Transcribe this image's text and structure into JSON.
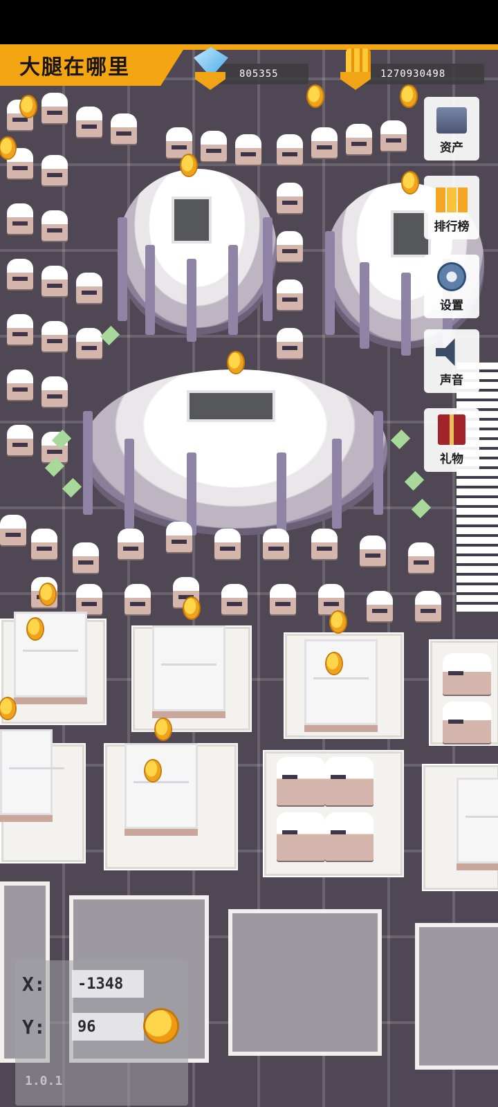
{
  "game": {
    "title": "大腿在哪里",
    "diamonds": "805355",
    "coins": "1270930498"
  },
  "side_menu": [
    {
      "label": "资产",
      "icon": "assets-icon"
    },
    {
      "label": "排行榜",
      "icon": "leaderboard-icon"
    },
    {
      "label": "设置",
      "icon": "gear-icon"
    },
    {
      "label": "声音",
      "icon": "speaker-icon"
    },
    {
      "label": "礼物",
      "icon": "gift-icon"
    }
  ],
  "coordinates": {
    "x_label": "X:",
    "x_value": "-1348",
    "y_label": "Y:",
    "y_value": "96"
  },
  "version": "1.0.1",
  "colors": {
    "accent": "#f3a512",
    "road": "#4f4854",
    "coin": "#ffc935"
  }
}
